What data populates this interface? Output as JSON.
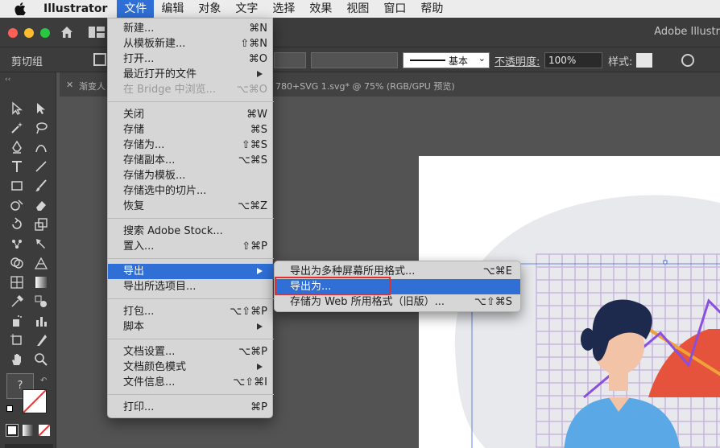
{
  "menubar": {
    "app_name": "Illustrator",
    "items": [
      "文件",
      "编辑",
      "对象",
      "文字",
      "选择",
      "效果",
      "视图",
      "窗口",
      "帮助"
    ]
  },
  "titlebar": {
    "title": "Adobe Illustr"
  },
  "controlbar": {
    "selection_label": "剪切组",
    "stroke_style_label": "基本",
    "opacity_label": "不透明度:",
    "opacity_value": "100%",
    "style_label": "样式:"
  },
  "tabs": {
    "tab1_label": "渐变人",
    "doc_title": "780+SVG 1.svg* @ 75% (RGB/GPU 预览)"
  },
  "file_menu": {
    "items": [
      {
        "label": "新建...",
        "shortcut": "⌘N"
      },
      {
        "label": "从模板新建...",
        "shortcut": "⇧⌘N"
      },
      {
        "label": "打开...",
        "shortcut": "⌘O"
      },
      {
        "label": "最近打开的文件",
        "shortcut": ""
      },
      {
        "label": "在 Bridge 中浏览...",
        "shortcut": "⌥⌘O"
      },
      {
        "label": "关闭",
        "shortcut": "⌘W"
      },
      {
        "label": "存储",
        "shortcut": "⌘S"
      },
      {
        "label": "存储为...",
        "shortcut": "⇧⌘S"
      },
      {
        "label": "存储副本...",
        "shortcut": "⌥⌘S"
      },
      {
        "label": "存储为模板...",
        "shortcut": ""
      },
      {
        "label": "存储选中的切片...",
        "shortcut": ""
      },
      {
        "label": "恢复",
        "shortcut": "⌥⌘Z"
      },
      {
        "label": "搜索 Adobe Stock...",
        "shortcut": ""
      },
      {
        "label": "置入...",
        "shortcut": "⇧⌘P"
      },
      {
        "label": "导出",
        "shortcut": ""
      },
      {
        "label": "导出所选项目...",
        "shortcut": ""
      },
      {
        "label": "打包...",
        "shortcut": "⌥⇧⌘P"
      },
      {
        "label": "脚本",
        "shortcut": ""
      },
      {
        "label": "文档设置...",
        "shortcut": "⌥⌘P"
      },
      {
        "label": "文档颜色模式",
        "shortcut": ""
      },
      {
        "label": "文件信息...",
        "shortcut": "⌥⇧⌘I"
      },
      {
        "label": "打印...",
        "shortcut": "⌘P"
      }
    ]
  },
  "export_submenu": {
    "items": [
      {
        "label": "导出为多种屏幕所用格式...",
        "shortcut": "⌥⌘E"
      },
      {
        "label": "导出为...",
        "shortcut": ""
      },
      {
        "label": "存储为 Web 所用格式（旧版）...",
        "shortcut": "⌥⇧⌘S"
      }
    ]
  },
  "colors": {
    "menu_highlight": "#2f6fd6",
    "annotation_box": "#e03131",
    "app_chrome": "#3c3c3c"
  }
}
